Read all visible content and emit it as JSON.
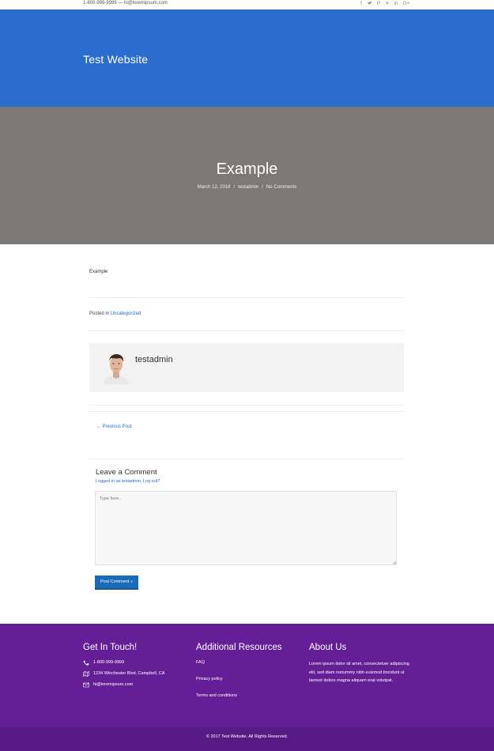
{
  "topbar": {
    "contact": "1-800-999-9999 — hi@loremipsum.com",
    "social_icons": [
      "facebook-icon",
      "twitter-icon",
      "pinterest-icon",
      "xing-icon",
      "linkedin-icon",
      "google-plus-icon"
    ]
  },
  "header": {
    "site_title": "Test Website"
  },
  "hero": {
    "post_title": "Example",
    "date": "March 12, 2018",
    "author": "testadmin",
    "comments": "No Comments",
    "separator": "/"
  },
  "post": {
    "body": "Example",
    "posted_in_label": "Posted in",
    "category": "Uncategorized"
  },
  "author_box": {
    "name": "testadmin"
  },
  "navigation": {
    "previous": "← Previous Post"
  },
  "comment": {
    "title": "Leave a Comment",
    "logged_in": "Logged in as testadmin. Log out?",
    "placeholder": "Type here..",
    "submit_label": "Post Comment »"
  },
  "footer": {
    "get_in_touch": {
      "title": "Get In Touch!",
      "phone": "1-800-999-9999",
      "address": "1234 Winchester Blvd, Campbell, CA",
      "email": "hi@loremipsum.com"
    },
    "resources": {
      "title": "Additional Resources",
      "links": [
        "FAQ",
        "Privacy policy",
        "Terms and conditions"
      ]
    },
    "about": {
      "title": "About Us",
      "text": "Lorem ipsum dolor sit amet, consectetuer adipiscing elit, sed diam nonummy nibh euismod tincidunt ut laoreet dolore magna aliquam erat volutpat."
    },
    "copyright": "© 2017 Test Website. All Rights Reserved."
  },
  "colors": {
    "header_blue": "#2b6dcc",
    "hero_gray": "#7b7876",
    "footer_purple": "#641f96",
    "button_blue": "#1c6bb8"
  }
}
